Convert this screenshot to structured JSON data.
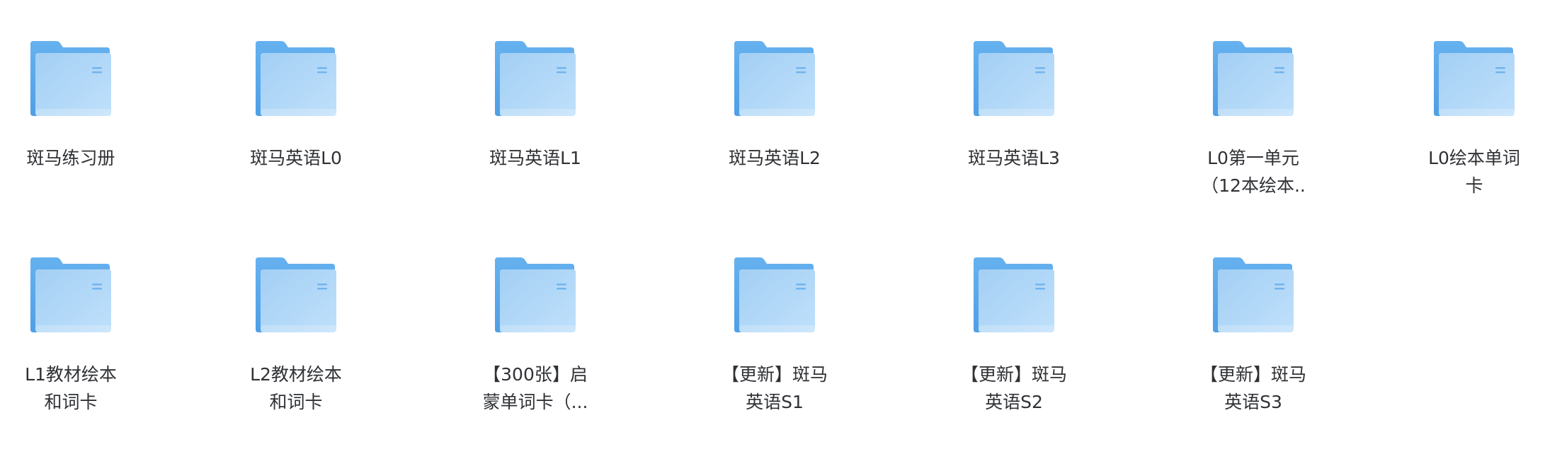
{
  "folders": [
    {
      "name": "斑马练习册"
    },
    {
      "name": "斑马英语L0"
    },
    {
      "name": "斑马英语L1"
    },
    {
      "name": "斑马英语L2"
    },
    {
      "name": "斑马英语L3"
    },
    {
      "name": "L0第一单元\n（12本绘本.."
    },
    {
      "name": "L0绘本单词\n卡"
    },
    {
      "name": "L1教材绘本\n和词卡"
    },
    {
      "name": "L2教材绘本\n和词卡"
    },
    {
      "name": "【300张】启\n蒙单词卡（..."
    },
    {
      "name": "【更新】斑马\n英语S1"
    },
    {
      "name": "【更新】斑马\n英语S2"
    },
    {
      "name": "【更新】斑马\n英语S3"
    }
  ],
  "icon": "folder-icon",
  "colors": {
    "folder_back": "#5aa9ec",
    "folder_front_top": "#a6d0f5",
    "folder_front_bottom": "#b8dcfa",
    "label_text": "#2f3135"
  }
}
